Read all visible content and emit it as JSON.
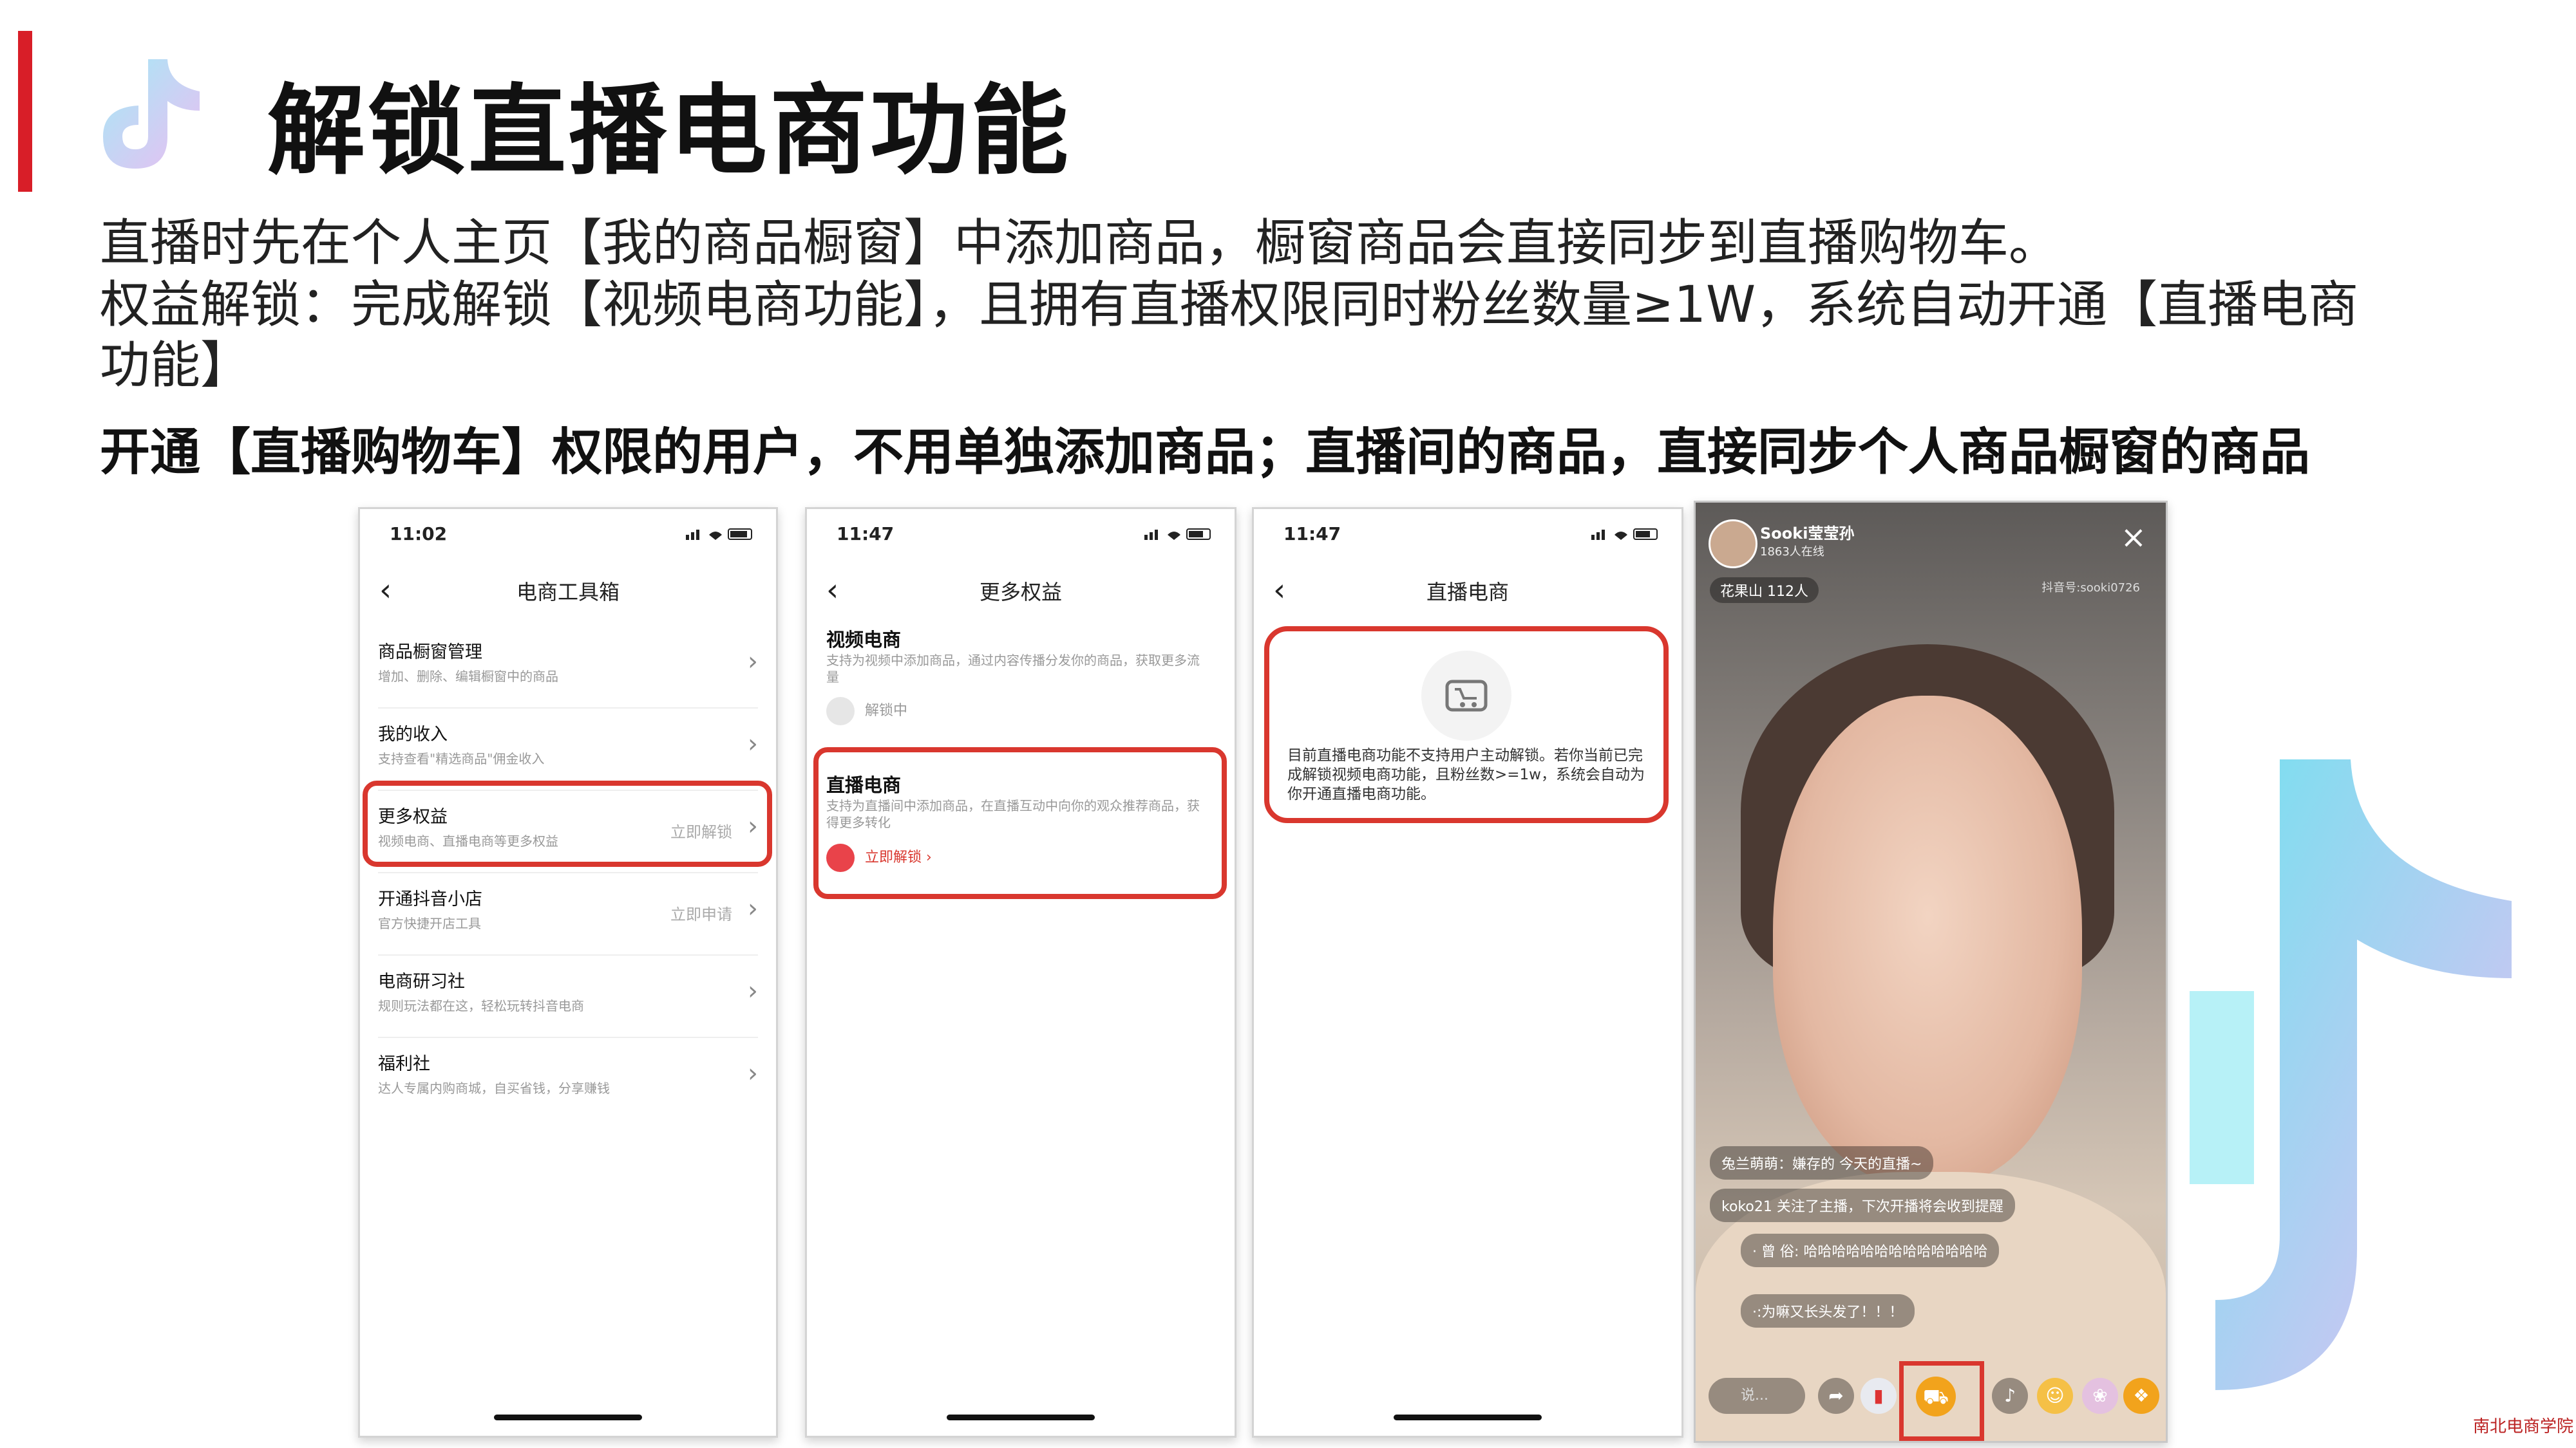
{
  "header": {
    "title": "解锁直播电商功能"
  },
  "body": {
    "line1": "直播时先在个人主页【我的商品橱窗】中添加商品，橱窗商品会直接同步到直播购物车。",
    "line2": "权益解锁：完成解锁【视频电商功能】，且拥有直播权限同时粉丝数量≥1W，系统自动开通【直播电商",
    "line3": "功能】",
    "bold_line": "开通【直播购物车】权限的用户，不用单独添加商品；直播间的商品，直接同步个人商品橱窗的商品"
  },
  "phone1": {
    "time": "11:02",
    "nav_title": "电商工具箱",
    "items": [
      {
        "title": "商品橱窗管理",
        "sub": "增加、删除、编辑橱窗中的商品",
        "right": ""
      },
      {
        "title": "我的收入",
        "sub": "支持查看\"精选商品\"佣金收入",
        "right": ""
      },
      {
        "title": "更多权益",
        "sub": "视频电商、直播电商等更多权益",
        "right": "立即解锁"
      },
      {
        "title": "开通抖音小店",
        "sub": "官方快捷开店工具",
        "right": "立即申请"
      },
      {
        "title": "电商研习社",
        "sub": "规则玩法都在这，轻松玩转抖音电商",
        "right": ""
      },
      {
        "title": "福利社",
        "sub": "达人专属内购商城，自买省钱，分享赚钱",
        "right": ""
      }
    ]
  },
  "phone2": {
    "time": "11:47",
    "nav_title": "更多权益",
    "sec1_title": "视频电商",
    "sec1_desc": "支持为视频中添加商品，通过内容传播分发你的商品，获取更多流量",
    "sec1_status": "解锁中",
    "sec2_title": "直播电商",
    "sec2_desc": "支持为直播间中添加商品，在直播互动中向你的观众推荐商品，获得更多转化",
    "sec2_action": "立即解锁 ›"
  },
  "phone3": {
    "time": "11:47",
    "nav_title": "直播电商",
    "message": "目前直播电商功能不支持用户主动解锁。若你当前已完成解锁视频电商功能，且粉丝数>=1w，系统会自动为你开通直播电商功能。"
  },
  "phone4": {
    "streamer_name": "Sooki莹莹孙",
    "viewers": "1863人在线",
    "tag": "花果山 112人",
    "id_text": "抖音号:sooki0726",
    "chat1": "兔兰萌萌：嫌存的 今天的直播~",
    "chat2": "koko21 关注了主播，下次开播将会收到提醒",
    "chat3": "· 曾 俗: 哈哈哈哈哈哈哈哈哈哈哈哈哈",
    "chat4": "·:为嘛又长头发了！！！",
    "input_placeholder": "说..."
  },
  "watermark": "南北电商学院",
  "colors": {
    "accent_red": "#d81e28",
    "highlight_red": "#d9372e",
    "cart_orange": "#f2a31c"
  }
}
